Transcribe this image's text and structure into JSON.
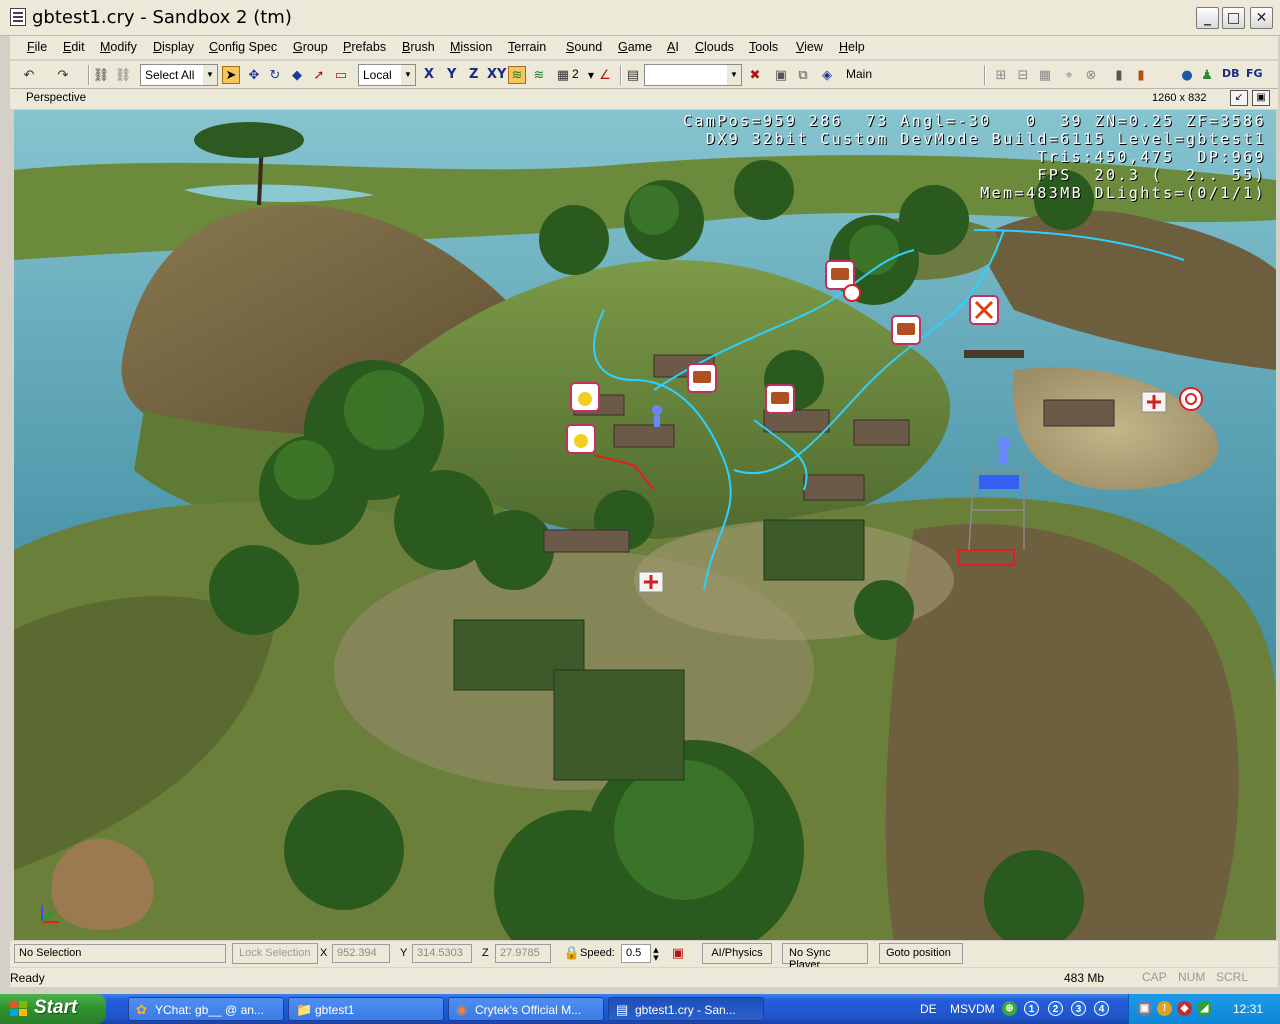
{
  "window": {
    "title": "gbtest1.cry - Sandbox 2 (tm)",
    "buttons": [
      "_",
      "□",
      "✕"
    ]
  },
  "menu": [
    "File",
    "Edit",
    "Modify",
    "Display",
    "Config Spec",
    "Group",
    "Prefabs",
    "Brush",
    "Mission",
    "Terrain",
    "Sound",
    "Game",
    "AI",
    "Clouds",
    "Tools",
    "View",
    "Help"
  ],
  "toolbar": {
    "select_all_label": "Select All",
    "coord_system": "Local",
    "axis_x": "X",
    "axis_y": "Y",
    "axis_z": "Z",
    "axis_xy": "XY",
    "snap_value": "2",
    "layer_label": "Main",
    "db_label": "DB",
    "fg_label": "FG"
  },
  "viewport": {
    "name": "Perspective",
    "resolution": "1260 x 832",
    "hud_lines": [
      "CamPos=959 286  73 Angl=-30   0  39 ZN=0.25 ZF=3586",
      "DX9 32bit Custom DevMode Build=6115 Level=gbtest1",
      "Tris:450,475  DP:969",
      "FPS  20.3 (  2.. 55)",
      "Mem=483MB DLights=(0/1/1)"
    ],
    "colors": {
      "water": "#6fb8c8",
      "grass": "#6f8a3c",
      "path": "#2fd0ff"
    }
  },
  "selection_bar": {
    "selection": "No Selection",
    "lock_selection": "Lock Selection",
    "x_label": "X",
    "x_value": "952.394",
    "y_label": "Y",
    "y_value": "314.5303",
    "z_label": "Z",
    "z_value": "27.9785",
    "speed_label": "Speed:",
    "speed_value": "0.5",
    "ai_physics": "AI/Physics",
    "no_sync": "No Sync Player",
    "goto": "Goto position"
  },
  "status": {
    "text": "Ready",
    "memory": "483 Mb",
    "cap": "CAP",
    "num": "NUM",
    "scrl": "SCRL"
  },
  "taskbar": {
    "start": "Start",
    "tasks": [
      {
        "label": "YChat: gb__ @ an...",
        "icon": "✿"
      },
      {
        "label": "gbtest1",
        "icon": "📁"
      },
      {
        "label": "Crytek's Official M...",
        "icon": "◉"
      },
      {
        "label": "gbtest1.cry - San...",
        "icon": "▤"
      }
    ],
    "lang": "DE",
    "msvdm": "MSVDM",
    "clock": "12:31",
    "badges": [
      "1",
      "2",
      "3",
      "4"
    ]
  }
}
